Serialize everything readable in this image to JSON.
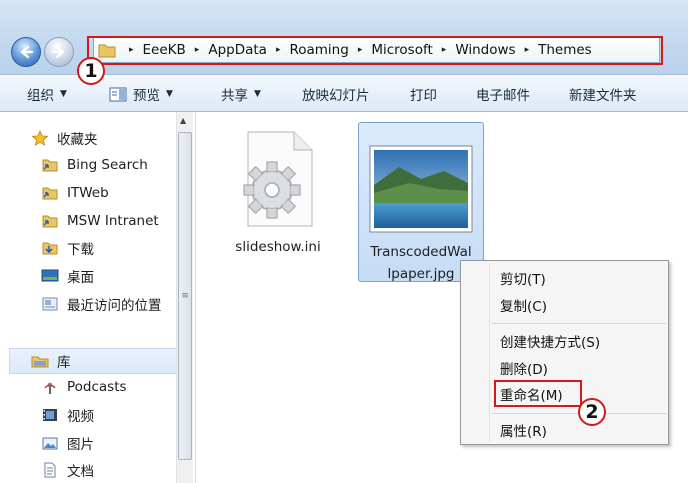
{
  "address_bar": {
    "back_icon": "back-arrow-icon",
    "forward_icon": "forward-arrow-icon",
    "folder_icon": "folder-icon",
    "breadcrumbs": [
      "EeeKB",
      "AppData",
      "Roaming",
      "Microsoft",
      "Windows",
      "Themes"
    ],
    "separator": "▸"
  },
  "toolbar": {
    "organize": "组织",
    "preview": "预览",
    "share": "共享",
    "slideshow": "放映幻灯片",
    "print": "打印",
    "email": "电子邮件",
    "new_folder": "新建文件夹",
    "dropdown_glyph": "▼"
  },
  "nav": {
    "favorites_header": "收藏夹",
    "favorites": [
      "Bing Search",
      "ITWeb",
      "MSW Intranet",
      "下载",
      "桌面",
      "最近访问的位置"
    ],
    "libraries_header": "库",
    "libraries": [
      "Podcasts",
      "视频",
      "图片",
      "文档"
    ],
    "scroll_up_glyph": "▲",
    "scroll_grip_glyph": "≡"
  },
  "files": [
    {
      "name": "slideshow.ini",
      "icon": "config-file-icon",
      "selected": false
    },
    {
      "name_line1": "TranscodedWal",
      "name_line2": "lpaper.jpg",
      "icon": "image-thumbnail",
      "selected": true
    }
  ],
  "context_menu": {
    "items": [
      "剪切(T)",
      "复制(C)",
      "创建快捷方式(S)",
      "删除(D)",
      "重命名(M)",
      "属性(R)"
    ]
  },
  "annotations": {
    "step1": "1",
    "step2": "2",
    "highlight_color": "#d11b1b"
  },
  "colors": {
    "selection_bg": "#c6dcf6",
    "toolbar_bg": "#dde9f6",
    "highlight": "#d11b1b"
  }
}
